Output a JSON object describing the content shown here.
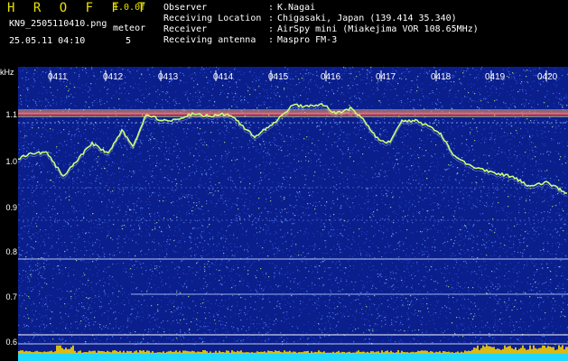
{
  "header": {
    "app_name": "H R O F F T",
    "version": "1.0.0f",
    "filename": "KN9_2505110410.png",
    "meteor_label": "meteor",
    "meteor_count": "5",
    "datetime": "25.05.11 04:10"
  },
  "info": [
    {
      "label": "Observer",
      "value": "K.Nagai"
    },
    {
      "label": "Receiving Location",
      "value": "Chigasaki, Japan (139.414 35.340)"
    },
    {
      "label": "Receiver",
      "value": "AirSpy mini (Miakejima VOR 108.65MHz)"
    },
    {
      "label": "Receiving antenna",
      "value": "Maspro FM-3"
    }
  ],
  "spectrogram": {
    "freq_unit": "kHz",
    "freq_ticks": [
      "1.1",
      "1.0",
      "0.9",
      "0.8",
      "0.7",
      "0.6"
    ],
    "time_ticks": [
      "0411",
      "0412",
      "0413",
      "0414",
      "0415",
      "0416",
      "0417",
      "0418",
      "0419",
      "0420"
    ],
    "colors": {
      "background": "#0a1e8c",
      "noise": "#2850dc",
      "carrier": "#ff6060",
      "trace": "#c8ff78",
      "bottom_band": "#20d8ff",
      "bright": "#ffd700"
    }
  }
}
